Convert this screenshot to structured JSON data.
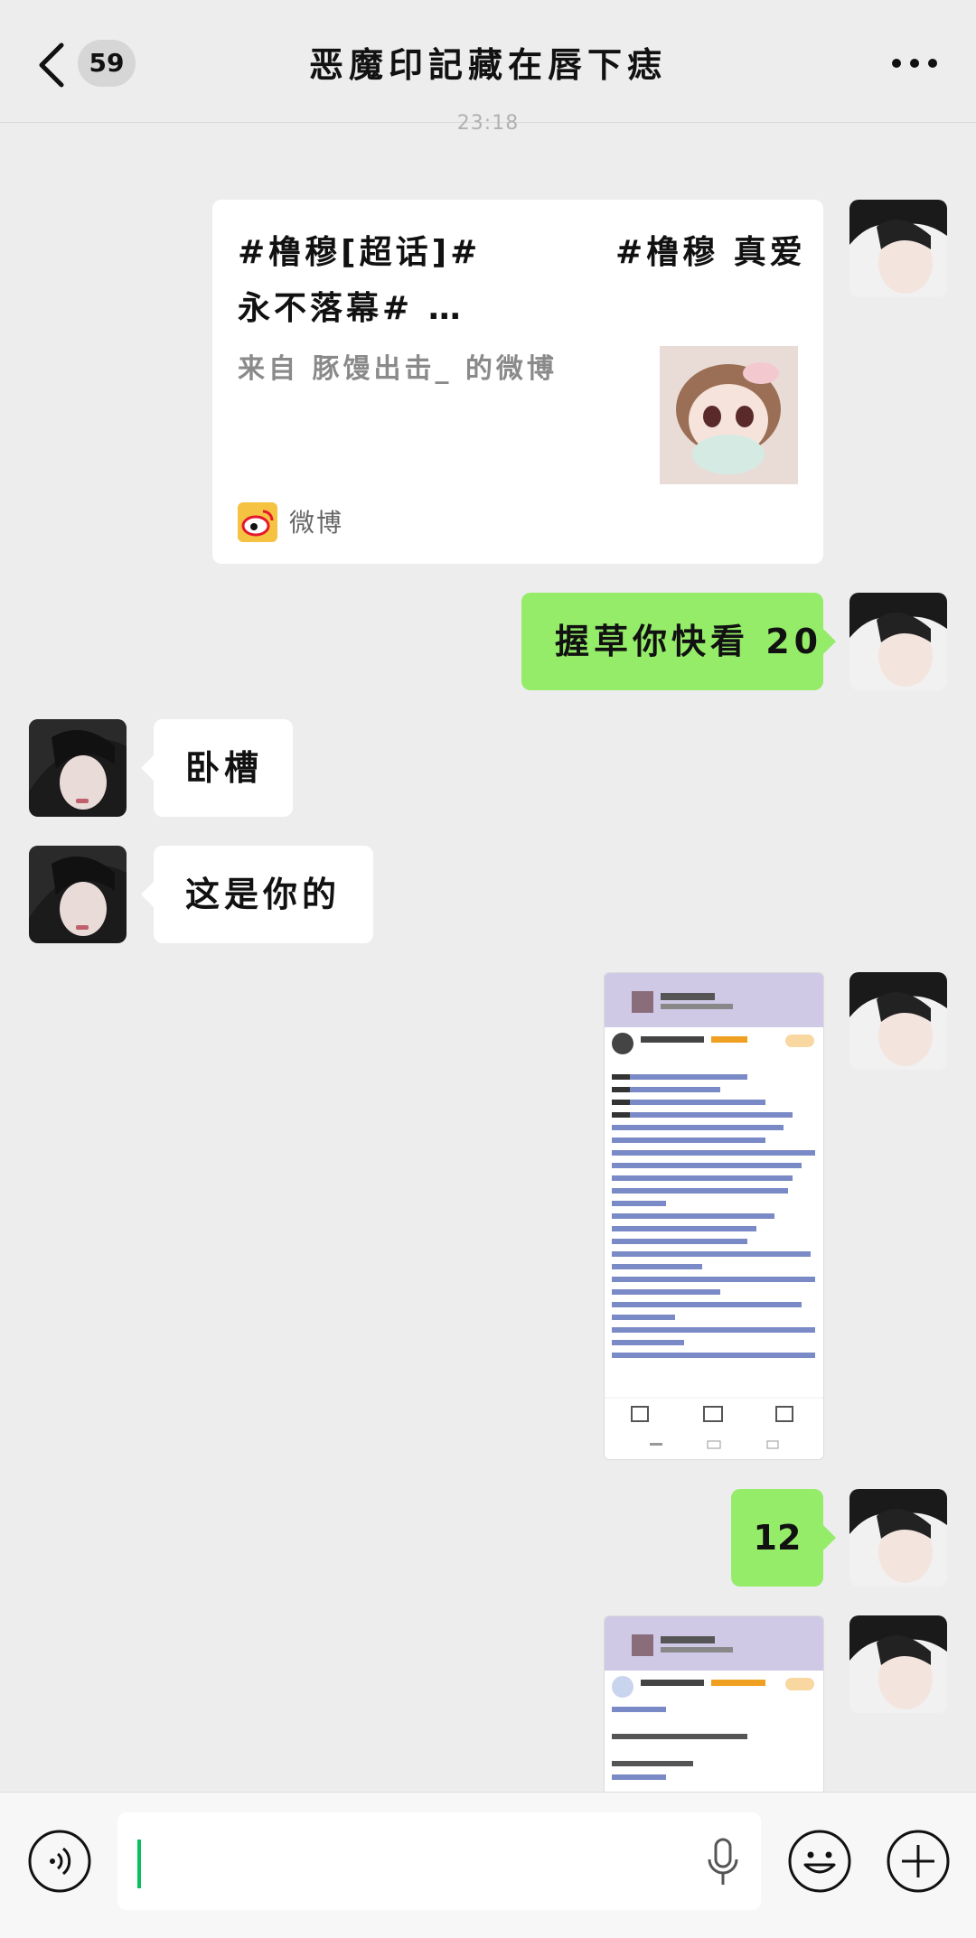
{
  "header": {
    "unread_count": "59",
    "title": "恶魔印記藏在唇下痣"
  },
  "timestamp": "23:18",
  "messages": [
    {
      "type": "share_card",
      "title": "#橹穆[超话]#         #橹穆 真爱\n永不落幕# …",
      "source": "来自 豚馒出击_ 的微博",
      "app_label": "微博"
    },
    {
      "type": "text",
      "text": "握草你快看 20"
    },
    {
      "type": "text",
      "text": "卧槽"
    },
    {
      "type": "text",
      "text": "这是你的"
    },
    {
      "type": "image",
      "alt": "微博截图"
    },
    {
      "type": "text",
      "text": "12"
    },
    {
      "type": "image",
      "alt": "微博截图"
    }
  ],
  "colors": {
    "background": "#ededed",
    "green_bubble": "#95ec69",
    "white_bubble": "#ffffff",
    "caret": "#07c160",
    "weibo_red": "#e6162d",
    "weibo_yellow": "#f5c242"
  },
  "icons": [
    "back-chevron-icon",
    "more-icon",
    "voice-icon",
    "microphone-icon",
    "emoji-icon",
    "plus-icon",
    "weibo-icon"
  ]
}
